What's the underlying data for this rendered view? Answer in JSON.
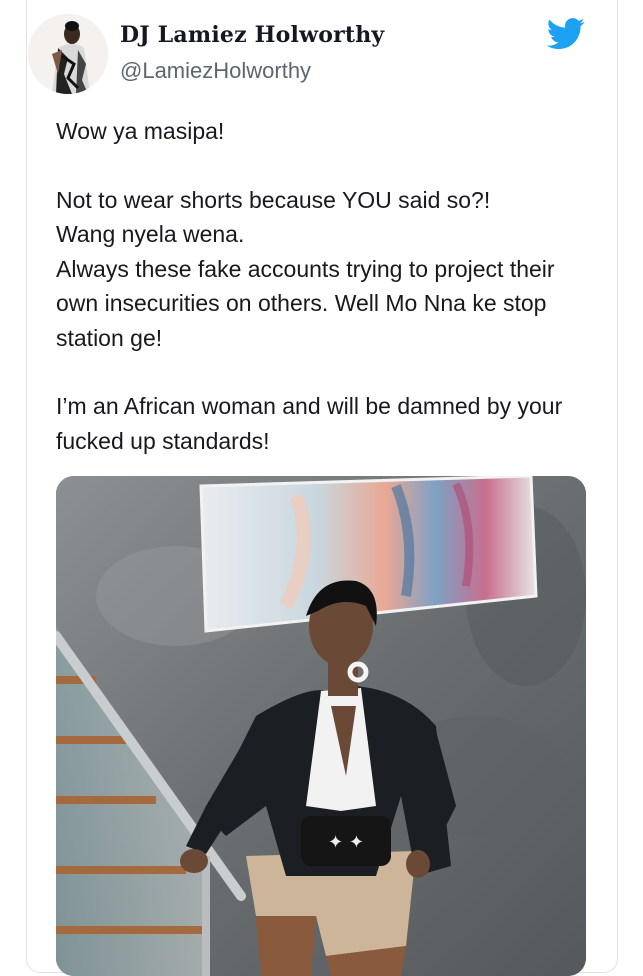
{
  "tweet": {
    "author": {
      "display_name": "DJ Lamiez Holworthy",
      "handle": "@LamiezHolworthy",
      "avatar_icon": "profile-photo"
    },
    "platform_icon": "twitter-bird-icon",
    "accent_color": "#1da1f2",
    "paragraphs": [
      "Wow ya masipa!",
      "Not to wear shorts because YOU said so?!\nWang nyela wena.\nAlways these fake accounts trying to project their own insecurities on others. Well Mo Nna ke stop station ge!",
      "I’m an African woman and will be damned by your fucked up standards!"
    ],
    "media": {
      "type": "photo",
      "subject": "woman-in-blazer-and-shorts-on-staircase"
    }
  }
}
